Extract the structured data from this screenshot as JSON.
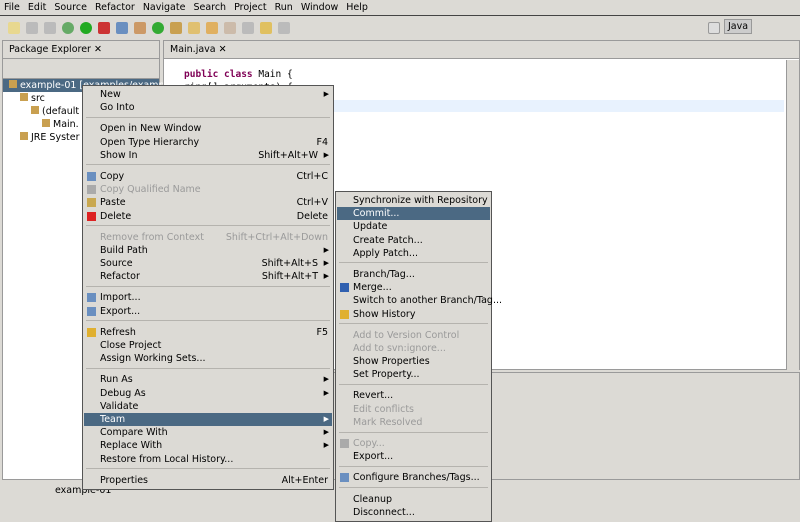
{
  "menubar": [
    "File",
    "Edit",
    "Source",
    "Refactor",
    "Navigate",
    "Search",
    "Project",
    "Run",
    "Window",
    "Help"
  ],
  "perspective": "Java",
  "package_explorer": {
    "title": "Package Explorer",
    "tree": [
      {
        "label": "example-01 [examples/examp",
        "indent": 0,
        "selected": true
      },
      {
        "label": "src",
        "indent": 1
      },
      {
        "label": "(default",
        "indent": 2
      },
      {
        "label": "Main.",
        "indent": 3
      },
      {
        "label": "JRE Syster",
        "indent": 1
      }
    ]
  },
  "editor": {
    "tab": "Main.java",
    "code": [
      {
        "kw": "public class ",
        "rest": "Main {"
      },
      {
        "kw": "",
        "rest": "                      ring[] arguments) {"
      }
    ]
  },
  "status": {
    "text": "example-01"
  },
  "context_menu": [
    {
      "label": "New",
      "arrow": true
    },
    {
      "label": "Go Into"
    },
    {
      "sep": true
    },
    {
      "label": "Open in New Window"
    },
    {
      "label": "Open Type Hierarchy",
      "acc": "F4"
    },
    {
      "label": "Show In",
      "acc": "Shift+Alt+W",
      "arrow": true
    },
    {
      "sep": true
    },
    {
      "label": "Copy",
      "acc": "Ctrl+C",
      "icon": "copy-icon",
      "color": "#6a8fc0"
    },
    {
      "label": "Copy Qualified Name",
      "disabled": true,
      "icon": "copy-qualified-icon",
      "color": "#aaa"
    },
    {
      "label": "Paste",
      "acc": "Ctrl+V",
      "icon": "paste-icon",
      "color": "#c9a850"
    },
    {
      "label": "Delete",
      "acc": "Delete",
      "icon": "delete-icon",
      "color": "#d22"
    },
    {
      "sep": true
    },
    {
      "label": "Remove from Context",
      "acc": "Shift+Ctrl+Alt+Down",
      "disabled": true
    },
    {
      "label": "Build Path",
      "arrow": true
    },
    {
      "label": "Source",
      "acc": "Shift+Alt+S",
      "arrow": true
    },
    {
      "label": "Refactor",
      "acc": "Shift+Alt+T",
      "arrow": true
    },
    {
      "sep": true
    },
    {
      "label": "Import...",
      "icon": "import-icon",
      "color": "#6a8fc0"
    },
    {
      "label": "Export...",
      "icon": "export-icon",
      "color": "#6a8fc0"
    },
    {
      "sep": true
    },
    {
      "label": "Refresh",
      "acc": "F5",
      "icon": "refresh-icon",
      "color": "#e0b030"
    },
    {
      "label": "Close Project"
    },
    {
      "label": "Assign Working Sets..."
    },
    {
      "sep": true
    },
    {
      "label": "Run As",
      "arrow": true
    },
    {
      "label": "Debug As",
      "arrow": true
    },
    {
      "label": "Validate"
    },
    {
      "label": "Team",
      "arrow": true,
      "selected": true
    },
    {
      "label": "Compare With",
      "arrow": true
    },
    {
      "label": "Replace With",
      "arrow": true
    },
    {
      "label": "Restore from Local History..."
    },
    {
      "sep": true
    },
    {
      "label": "Properties",
      "acc": "Alt+Enter"
    }
  ],
  "team_menu": [
    {
      "label": "Synchronize with Repository"
    },
    {
      "label": "Commit...",
      "selected": true
    },
    {
      "label": "Update"
    },
    {
      "label": "Create Patch..."
    },
    {
      "label": "Apply Patch..."
    },
    {
      "sep": true
    },
    {
      "label": "Branch/Tag..."
    },
    {
      "label": "Merge...",
      "icon": "merge-icon",
      "color": "#3060b0"
    },
    {
      "label": "Switch to another Branch/Tag..."
    },
    {
      "label": "Show History",
      "icon": "history-icon",
      "color": "#e0b030"
    },
    {
      "sep": true
    },
    {
      "label": "Add to Version Control",
      "disabled": true
    },
    {
      "label": "Add to svn:ignore...",
      "disabled": true
    },
    {
      "label": "Show Properties"
    },
    {
      "label": "Set Property..."
    },
    {
      "sep": true
    },
    {
      "label": "Revert..."
    },
    {
      "label": "Edit conflicts",
      "disabled": true
    },
    {
      "label": "Mark Resolved",
      "disabled": true
    },
    {
      "sep": true
    },
    {
      "label": "Copy...",
      "disabled": true,
      "icon": "copy-icon",
      "color": "#aaa"
    },
    {
      "label": "Export..."
    },
    {
      "sep": true
    },
    {
      "label": "Configure Branches/Tags...",
      "icon": "configure-icon",
      "color": "#6a8fc0"
    },
    {
      "sep": true
    },
    {
      "label": "Cleanup"
    },
    {
      "label": "Disconnect..."
    }
  ]
}
